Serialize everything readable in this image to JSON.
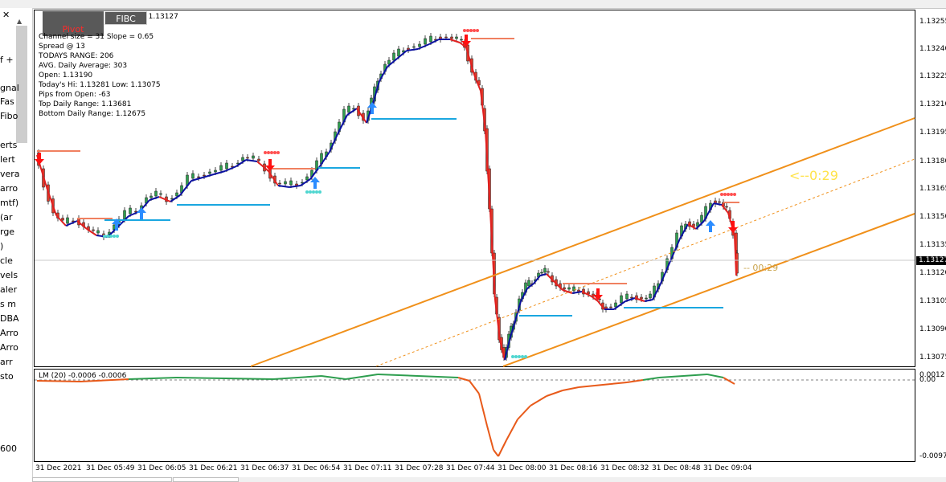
{
  "left_panel": {
    "close_glyph": "✕",
    "items": [
      "f +",
      "gnal",
      "Fas",
      "Fibo",
      "erts",
      "lert",
      "vera",
      "arro",
      "mtf)",
      "(ar",
      "rge",
      ")",
      "cle",
      "vels",
      "aler",
      "s m",
      "DBA",
      "Arro",
      "Arro",
      "arr",
      "sto",
      "600"
    ]
  },
  "buttons": {
    "top_left": "",
    "pivot": "Pivot",
    "fibc": "FIBC"
  },
  "symbol_line": "7 1.13118 1.13127",
  "info": {
    "channel": "Channel size = 31 Slope = 0.65",
    "spread": "Spread @ 13",
    "todays_range": "TODAYS RANGE: 206",
    "avg_daily": "AVG. Daily Average: 303",
    "open": "Open: 1.13190",
    "hi_low": "Today's Hi: 1.13281  Low: 1.13075",
    "pips_from_open": "Pips from Open: -63",
    "top_daily": "Top Daily Range: 1.13681",
    "bottom_daily": "Bottom Daily Range: 1.12675"
  },
  "timers": {
    "big": "<--0:29",
    "small": "-- 00:29"
  },
  "price_axis": {
    "labels": [
      "1.13255",
      "1.13240",
      "1.13225",
      "1.13210",
      "1.13195",
      "1.13180",
      "1.13165",
      "1.13150",
      "1.13135",
      "1.13120",
      "1.13105",
      "1.13090",
      "1.13075"
    ],
    "current": "1.13127"
  },
  "time_axis": [
    "31 Dec 2021",
    "31 Dec 05:49",
    "31 Dec 06:05",
    "31 Dec 06:21",
    "31 Dec 06:37",
    "31 Dec 06:54",
    "31 Dec 07:11",
    "31 Dec 07:28",
    "31 Dec 07:44",
    "31 Dec 08:00",
    "31 Dec 08:16",
    "31 Dec 08:32",
    "31 Dec 08:48",
    "31 Dec 09:04"
  ],
  "subwindow": {
    "title": "LM (20) -0.0006 -0.0006",
    "labels": [
      "0.0012",
      "0.00",
      "-0.0097"
    ]
  },
  "colors": {
    "bull": "#2e9e4f",
    "bear": "#e03a2a",
    "line_up": "#0a10a0",
    "line_down": "#e02020",
    "channel": "#f0901a",
    "signal_up": "#2b8cff",
    "signal_down": "#ff1010",
    "support": "#1aa7e0",
    "resistance": "#f08060",
    "lm_pos": "#2e9e4f",
    "lm_neg": "#e85a1a"
  },
  "icons": {
    "buy_arrow": "arrow-up-icon",
    "sell_arrow": "arrow-down-icon"
  }
}
